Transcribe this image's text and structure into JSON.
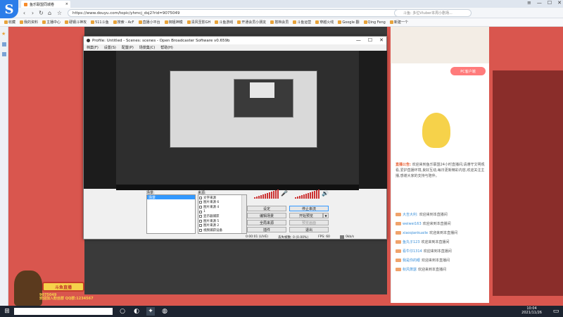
{
  "browser": {
    "tab_title": "鱼乐联盟同城卷",
    "url": "https://www.douyu.com/topic/yhmcj_dsj2?rid=9075049",
    "search_placeholder": "斗鱼: 多位Vtuber本周小剧场...",
    "bookmarks": [
      "收藏",
      "我的资料",
      "主播中心",
      "硬钢斗神攻",
      "511斗鱼",
      "搜索 - AcF",
      "直播小平台",
      "御姐神模",
      "清风至影GH",
      "斗鱼游戏",
      "开通会员小朋友",
      "搭档会员",
      "斗鱼运营",
      "穿越火线",
      "Google 翻",
      "Qing Feng",
      "新建一个"
    ]
  },
  "obs": {
    "title": "Profile: Untitled - Scenes: scenes - Open Broadcaster Software v0.659b",
    "menu": [
      "档案(F)",
      "设置(S)",
      "配置(P)",
      "场景集(C)",
      "帮助(H)"
    ],
    "scenes_label": "场景:",
    "sources_label": "来源:",
    "scene_selected": "场景",
    "sources": [
      "文字来源",
      "图片来源 6",
      "图片来源 4",
      "1",
      "显示器捕获",
      "图片来源 5",
      "图片来源 2",
      "视频捕获设备"
    ],
    "buttons": {
      "settings": "设定",
      "stop_stream": "停止串流",
      "edit_scene": "编辑场景",
      "start_record": "开始预览",
      "global_sources": "全局来源",
      "plugins": "插件",
      "exit": "退出",
      "preview_alt": "预览画面",
      "delay": "延迟"
    },
    "status": {
      "time": "0:00:01 (LIVE)",
      "dropped": "丢失帧数: 0 (0.00%)",
      "fps": "FPS: 60",
      "bitrate": "0kb/s"
    }
  },
  "page": {
    "live_btn": "PC客户端",
    "announce_title": "直播公告:",
    "announce_text": "欢迎来到鱼乐联盟24小时直播间,请遵守文明观看,爱护直播环境,良好互动,每日更新精彩内容,欢迎关注主播,感谢大家的支持与陪伴。",
    "chats": [
      {
        "nick": "大吉大利:",
        "msg": "欢迎来到本直播间"
      },
      {
        "nick": "weiwei163",
        "msg": "欢迎来到本直播间"
      },
      {
        "nick": "xiaoqiankuaile",
        "msg": "欢迎来到本直播间"
      },
      {
        "nick": "鱼丸子123",
        "msg": "欢迎来到本直播间"
      },
      {
        "nick": "看牛仔1314",
        "msg": "欢迎来到本直播间"
      },
      {
        "nick": "我是你的眼",
        "msg": "欢迎来到本直播间"
      },
      {
        "nick": "秋风萧瑟",
        "msg": "欢迎来到本直播间"
      }
    ]
  },
  "sticker": {
    "label": "斗鱼直播",
    "number": "9075049",
    "sub": "欢迎加入粉丝群 QQ群:1234567"
  },
  "taskbar": {
    "time": "10:04",
    "date": "2021/11/26"
  },
  "colors": {
    "accent": "#2b7de9",
    "obs_selected": "#3399ff",
    "meter": "#cc3333",
    "page_bg": "#d9564e"
  }
}
